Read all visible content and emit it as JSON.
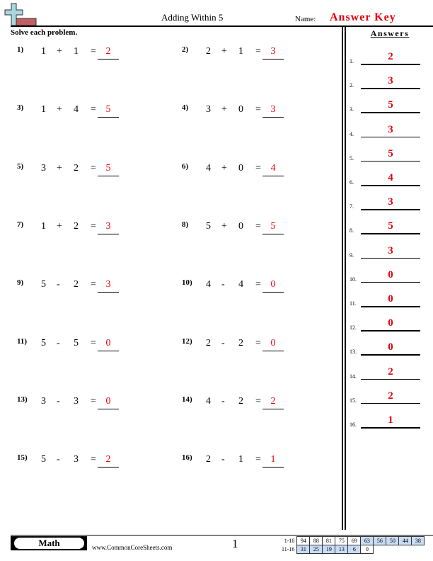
{
  "header": {
    "title": "Adding Within 5",
    "name_label": "Name:",
    "name_value": "Answer Key",
    "instructions": "Solve each problem.",
    "answers_heading": "Answers"
  },
  "colors": {
    "answer_red": "#e8000b",
    "score_highlight": "#c9dcf5",
    "logo_cross": "#a9d7e0",
    "logo_bar": "#c06060"
  },
  "problems": [
    {
      "num": "1)",
      "a": "1",
      "op": "+",
      "b": "1",
      "eq": "=",
      "answer": "2"
    },
    {
      "num": "2)",
      "a": "2",
      "op": "+",
      "b": "1",
      "eq": "=",
      "answer": "3"
    },
    {
      "num": "3)",
      "a": "1",
      "op": "+",
      "b": "4",
      "eq": "=",
      "answer": "5"
    },
    {
      "num": "4)",
      "a": "3",
      "op": "+",
      "b": "0",
      "eq": "=",
      "answer": "3"
    },
    {
      "num": "5)",
      "a": "3",
      "op": "+",
      "b": "2",
      "eq": "=",
      "answer": "5"
    },
    {
      "num": "6)",
      "a": "4",
      "op": "+",
      "b": "0",
      "eq": "=",
      "answer": "4"
    },
    {
      "num": "7)",
      "a": "1",
      "op": "+",
      "b": "2",
      "eq": "=",
      "answer": "3"
    },
    {
      "num": "8)",
      "a": "5",
      "op": "+",
      "b": "0",
      "eq": "=",
      "answer": "5"
    },
    {
      "num": "9)",
      "a": "5",
      "op": "-",
      "b": "2",
      "eq": "=",
      "answer": "3"
    },
    {
      "num": "10)",
      "a": "4",
      "op": "-",
      "b": "4",
      "eq": "=",
      "answer": "0"
    },
    {
      "num": "11)",
      "a": "5",
      "op": "-",
      "b": "5",
      "eq": "=",
      "answer": "0"
    },
    {
      "num": "12)",
      "a": "2",
      "op": "-",
      "b": "2",
      "eq": "=",
      "answer": "0"
    },
    {
      "num": "13)",
      "a": "3",
      "op": "-",
      "b": "3",
      "eq": "=",
      "answer": "0"
    },
    {
      "num": "14)",
      "a": "4",
      "op": "-",
      "b": "2",
      "eq": "=",
      "answer": "2"
    },
    {
      "num": "15)",
      "a": "5",
      "op": "-",
      "b": "3",
      "eq": "=",
      "answer": "2"
    },
    {
      "num": "16)",
      "a": "2",
      "op": "-",
      "b": "1",
      "eq": "=",
      "answer": "1"
    }
  ],
  "answer_key": [
    {
      "num": "1.",
      "value": "2"
    },
    {
      "num": "2.",
      "value": "3"
    },
    {
      "num": "3.",
      "value": "5"
    },
    {
      "num": "4.",
      "value": "3"
    },
    {
      "num": "5.",
      "value": "5"
    },
    {
      "num": "6.",
      "value": "4"
    },
    {
      "num": "7.",
      "value": "3"
    },
    {
      "num": "8.",
      "value": "5"
    },
    {
      "num": "9.",
      "value": "3"
    },
    {
      "num": "10.",
      "value": "0"
    },
    {
      "num": "11.",
      "value": "0"
    },
    {
      "num": "12.",
      "value": "0"
    },
    {
      "num": "13.",
      "value": "0"
    },
    {
      "num": "14.",
      "value": "2"
    },
    {
      "num": "15.",
      "value": "2"
    },
    {
      "num": "16.",
      "value": "1"
    }
  ],
  "footer": {
    "badge": "Math",
    "site": "www.CommonCoreSheets.com",
    "page": "1",
    "score_rows": [
      {
        "label": "1-10",
        "cells": [
          {
            "v": "94",
            "hl": false
          },
          {
            "v": "88",
            "hl": false
          },
          {
            "v": "81",
            "hl": false
          },
          {
            "v": "75",
            "hl": false
          },
          {
            "v": "69",
            "hl": false
          },
          {
            "v": "63",
            "hl": true
          },
          {
            "v": "56",
            "hl": true
          },
          {
            "v": "50",
            "hl": true
          },
          {
            "v": "44",
            "hl": true
          },
          {
            "v": "38",
            "hl": true
          }
        ]
      },
      {
        "label": "11-16",
        "cells": [
          {
            "v": "31",
            "hl": true
          },
          {
            "v": "25",
            "hl": true
          },
          {
            "v": "19",
            "hl": true
          },
          {
            "v": "13",
            "hl": true
          },
          {
            "v": "6",
            "hl": true
          },
          {
            "v": "0",
            "hl": false
          }
        ]
      }
    ]
  }
}
